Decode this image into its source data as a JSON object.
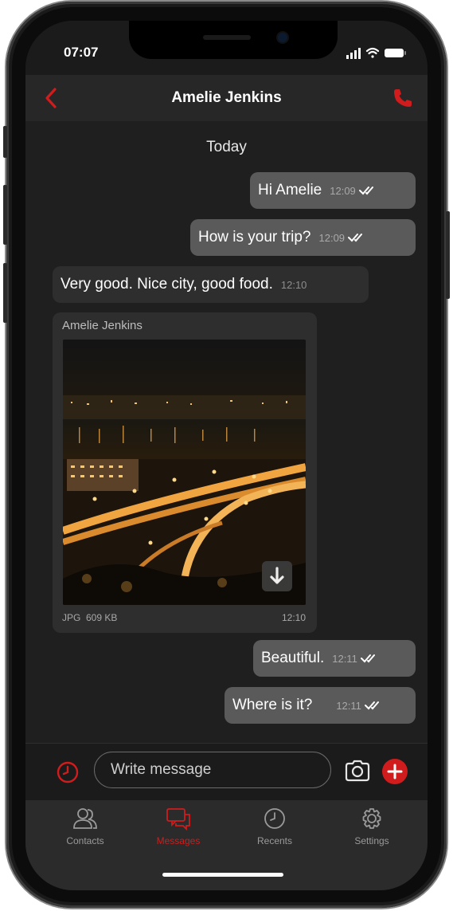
{
  "status_bar": {
    "time": "07:07",
    "signal_icon": "signal-bars-icon",
    "wifi_icon": "wifi-icon",
    "battery_icon": "battery-icon"
  },
  "header": {
    "title": "Amelie Jenkins",
    "back_icon": "chevron-left-icon",
    "call_icon": "phone-icon"
  },
  "chat": {
    "date_label": "Today",
    "messages": [
      {
        "direction": "outgoing",
        "text": "Hi Amelie",
        "time": "12:09",
        "read": true
      },
      {
        "direction": "outgoing",
        "text": "How is your trip?",
        "time": "12:09",
        "read": true
      },
      {
        "direction": "incoming",
        "text": "Very good. Nice city, good food.",
        "time": "12:10"
      },
      {
        "direction": "incoming",
        "type": "image",
        "sender": "Amelie Jenkins",
        "file_info": "JPG  609 KB",
        "time": "12:10",
        "image_icon": "night-city-photo",
        "download_icon": "download-arrow-icon"
      },
      {
        "direction": "outgoing",
        "text": "Beautiful.",
        "time": "12:11",
        "read": true
      },
      {
        "direction": "outgoing",
        "text": "Where is it?",
        "time": "12:11",
        "read": true
      }
    ]
  },
  "composer": {
    "placeholder": "Write message",
    "value": "",
    "timer_icon": "clock-icon",
    "camera_icon": "camera-icon",
    "add_icon": "plus-circle-icon"
  },
  "tabs": [
    {
      "label": "Contacts",
      "icon": "contacts-icon",
      "active": false
    },
    {
      "label": "Messages",
      "icon": "messages-icon",
      "active": true
    },
    {
      "label": "Recents",
      "icon": "clock-icon",
      "active": false
    },
    {
      "label": "Settings",
      "icon": "gear-icon",
      "active": false
    }
  ],
  "colors": {
    "accent": "#d01c1c",
    "background": "#1f1f1f",
    "bubble_outgoing": "#5a5a5a",
    "bubble_incoming": "#2e2e2e"
  }
}
